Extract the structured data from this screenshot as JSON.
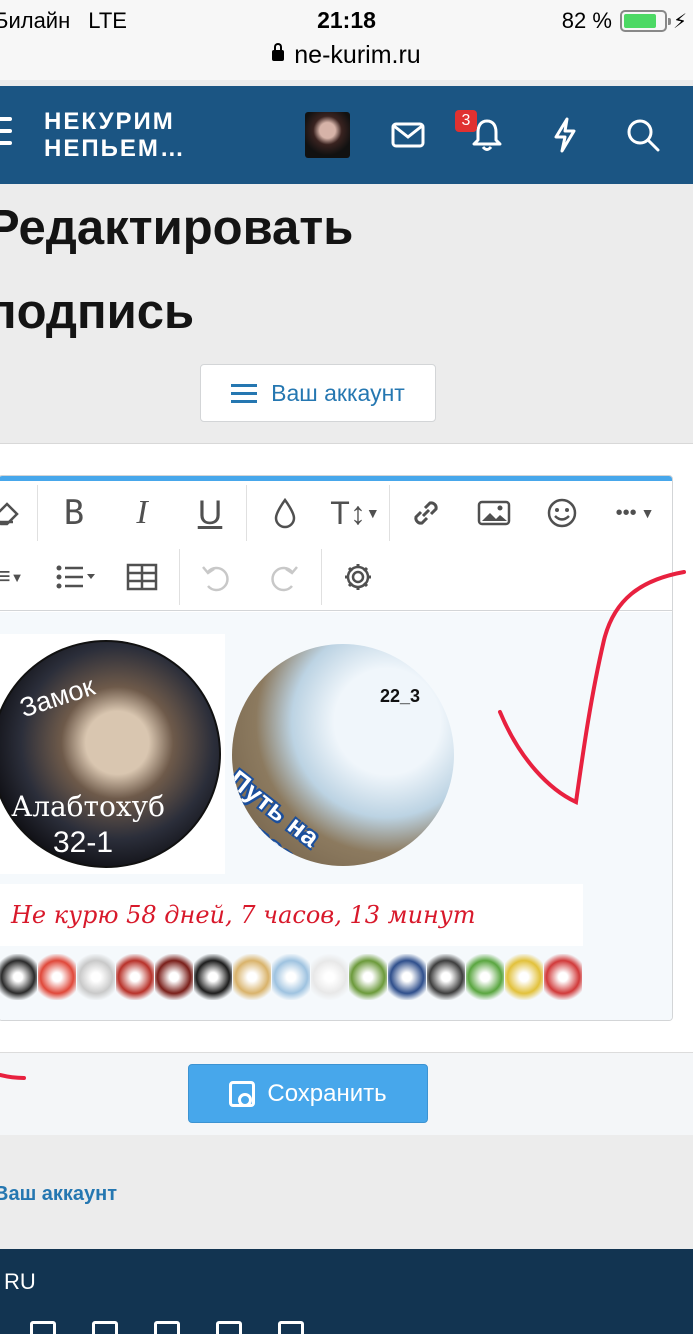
{
  "status_bar": {
    "carrier": "Билайн",
    "network": "LTE",
    "time": "21:18",
    "battery_percent": "82 %",
    "battery_level": 0.82,
    "url": "ne-kurim.ru"
  },
  "navbar": {
    "logo_line1": "НЕКУРИМ",
    "logo_line2": "НЕПЬЕМ…",
    "notifications_count": "3",
    "icons": [
      "menu-icon",
      "avatar",
      "mail-icon",
      "bell-icon",
      "lightning-icon",
      "search-icon"
    ]
  },
  "page": {
    "title_line1": "Редактировать",
    "title_line2": "подпись",
    "account_button": "Ваш аккаунт"
  },
  "editor": {
    "toolbar_row1": [
      "eraser-icon",
      "bold-icon",
      "italic-icon",
      "underline-icon",
      "color-icon",
      "text-size-icon",
      "link-icon",
      "image-icon",
      "smiley-icon",
      "more-icon"
    ],
    "toolbar_row2": [
      "align-icon",
      "list-icon",
      "table-icon",
      "undo-icon",
      "redo-icon",
      "settings-icon"
    ],
    "bold_glyph": "B",
    "italic_glyph": "I",
    "underline_glyph": "U",
    "text_size_glyph": "T↕",
    "more_glyph": "•••",
    "signature": {
      "image1_line1": "Замок",
      "image1_line2": "Алабтохуб",
      "image1_line3": "32-1",
      "image2_number": "22_3",
      "image2_text": "Путь на Эверест",
      "counter_text": "Не курю  58 дней, 7 часов, 13 минут",
      "sticker_colors": [
        "#2b2b2b",
        "#e0483a",
        "#c9c9c9",
        "#b8322a",
        "#7a1f1a",
        "#1d1d1d",
        "#d9b36b",
        "#9fc3e0",
        "#e8e8e8",
        "#6c9a3b",
        "#2f4f8c",
        "#3e3e3e",
        "#5aa640",
        "#e2c13b",
        "#d13a3a"
      ]
    }
  },
  "actions": {
    "save_label": "Сохранить"
  },
  "breadcrumb": {
    "label": "Ваш аккаунт"
  },
  "footer": {
    "language": "RU"
  },
  "colors": {
    "navbar": "#1b5583",
    "accent": "#47a7eb",
    "link": "#2577b1",
    "annotation": "#e8213f"
  }
}
